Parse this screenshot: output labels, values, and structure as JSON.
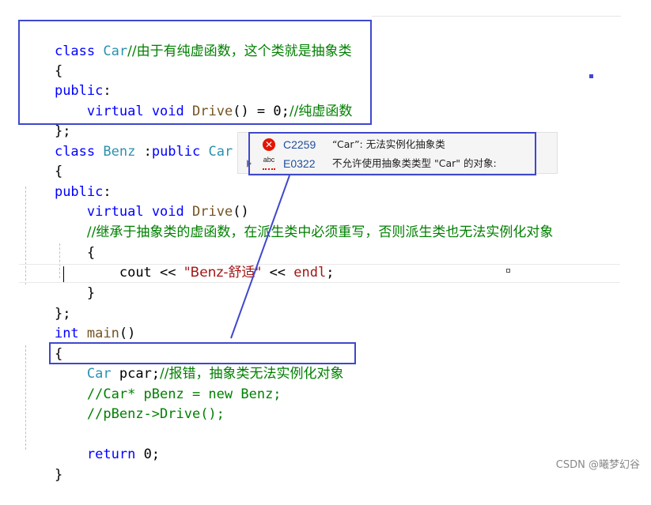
{
  "editor": {
    "lines": {
      "l1_kw": "class",
      "l1_ty": "Car",
      "l1_cm": "//由于有纯虚函数，这个类就是抽象类",
      "l2": "{",
      "l3_kw": "public",
      "l3_p": ":",
      "l4_kw1": "virtual",
      "l4_kw2": "void",
      "l4_fn": "Drive",
      "l4_p": "() = 0;",
      "l4_cm": "//纯虚函数",
      "l5": "};",
      "l6_kw": "class",
      "l6_ty1": "Benz",
      "l6_p": " :",
      "l6_kw2": "public",
      "l6_ty2": "Car",
      "l7": "{",
      "l8_kw": "public",
      "l8_p": ":",
      "l9_kw1": "virtual",
      "l9_kw2": "void",
      "l9_fn": "Drive",
      "l9_p": "()",
      "l10_cm": "//继承于抽象类的虚函数，在派生类中必须重写，否则派生类也无法实例化对象",
      "l11": "{",
      "l12_p1": "cout << ",
      "l12_st": "\"Benz-舒适\"",
      "l12_p2": " << ",
      "l12_fn": "endl",
      "l12_p3": ";",
      "l13": "}",
      "l14": "};",
      "l15_kw": "int",
      "l15_fn": "main",
      "l15_p": "()",
      "l16": "{",
      "l17_ty": "Car",
      "l17_p": " pcar;",
      "l17_cm": "//报错，抽象类无法实例化对象",
      "l18_cm": "//Car* pBenz = new Benz;",
      "l19_cm": "//pBenz->Drive();",
      "l21_kw": "return",
      "l21_p": " 0;",
      "l22": "}"
    }
  },
  "errors": [
    {
      "icon": "error-icon",
      "code": "C2259",
      "message": "“Car”: 无法实例化抽象类"
    },
    {
      "icon": "spell-squiggle-icon",
      "code": "E0322",
      "message": "不允许使用抽象类类型 \"Car\" 的对象:"
    }
  ],
  "watermark": "CSDN @曦梦幻谷",
  "colors": {
    "keyword": "#0000ff",
    "type": "#2b91af",
    "function": "#74531f",
    "string": "#a31515",
    "comment": "#008000",
    "annotation": "#3f48cc",
    "error": "#e51400"
  }
}
